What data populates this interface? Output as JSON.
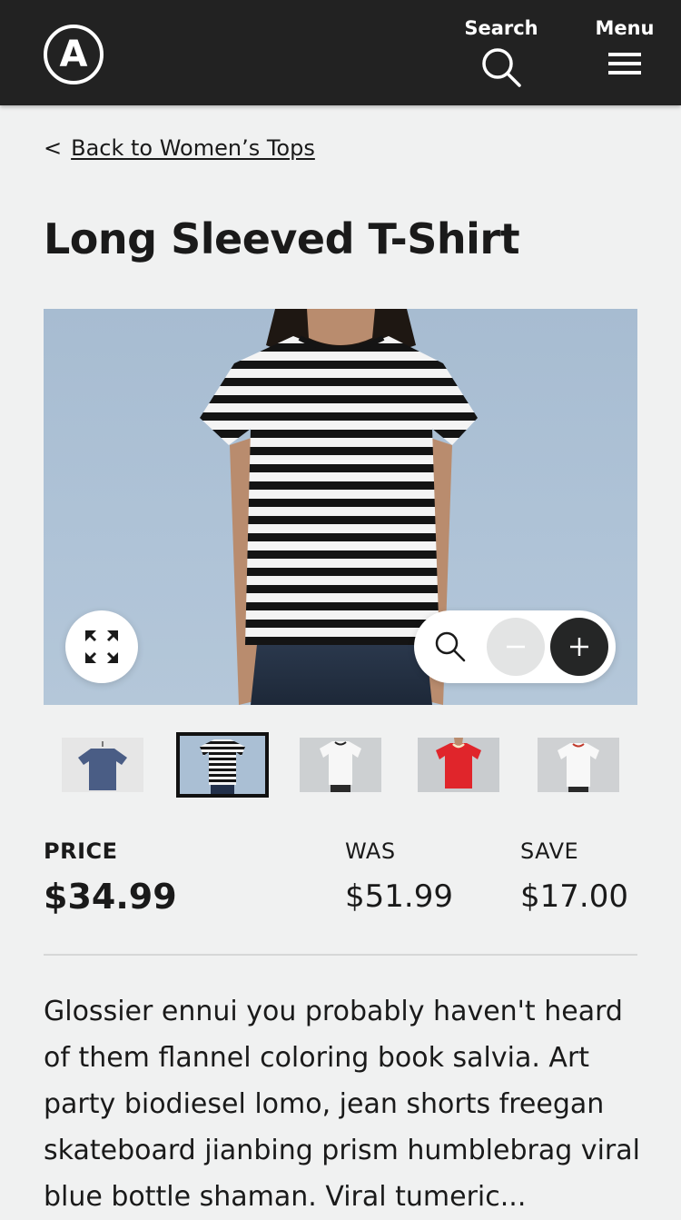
{
  "header": {
    "logo_letter": "A",
    "search_label": "Search",
    "menu_label": "Menu",
    "background": "#222222"
  },
  "breadcrumb": {
    "chevron": "<",
    "link_text": "Back to Women’s Tops"
  },
  "product": {
    "title": "Long Sleeved T-Shirt",
    "image_icons": [
      "expand-icon",
      "magnifier-icon",
      "minus-icon",
      "plus-icon"
    ],
    "thumbnails": [
      {
        "name": "thumbnail-blue-tshirt-hanger",
        "selected": false
      },
      {
        "name": "thumbnail-striped-tshirt",
        "selected": true
      },
      {
        "name": "thumbnail-white-tshirt",
        "selected": false
      },
      {
        "name": "thumbnail-red-tshirt",
        "selected": false
      },
      {
        "name": "thumbnail-white-ringer-tshirt",
        "selected": false
      }
    ]
  },
  "pricing": {
    "price_label": "PRICE",
    "price_value": "$34.99",
    "was_label": "WAS",
    "was_value": "$51.99",
    "save_label": "SAVE",
    "save_value": "$17.00"
  },
  "description": "Glossier ennui you probably haven't heard of them flannel coloring book salvia. Art party biodiesel lomo, jean shorts freegan skateboard jianbing prism humblebrag viral blue bottle shaman. Viral tumeric...",
  "colors": {
    "page_background": "#f0f1f1",
    "text": "#1a1a1a",
    "image_background": "#afc3d7",
    "zoom_in_button": "#252626",
    "zoom_out_button": "#e3e4e4"
  }
}
